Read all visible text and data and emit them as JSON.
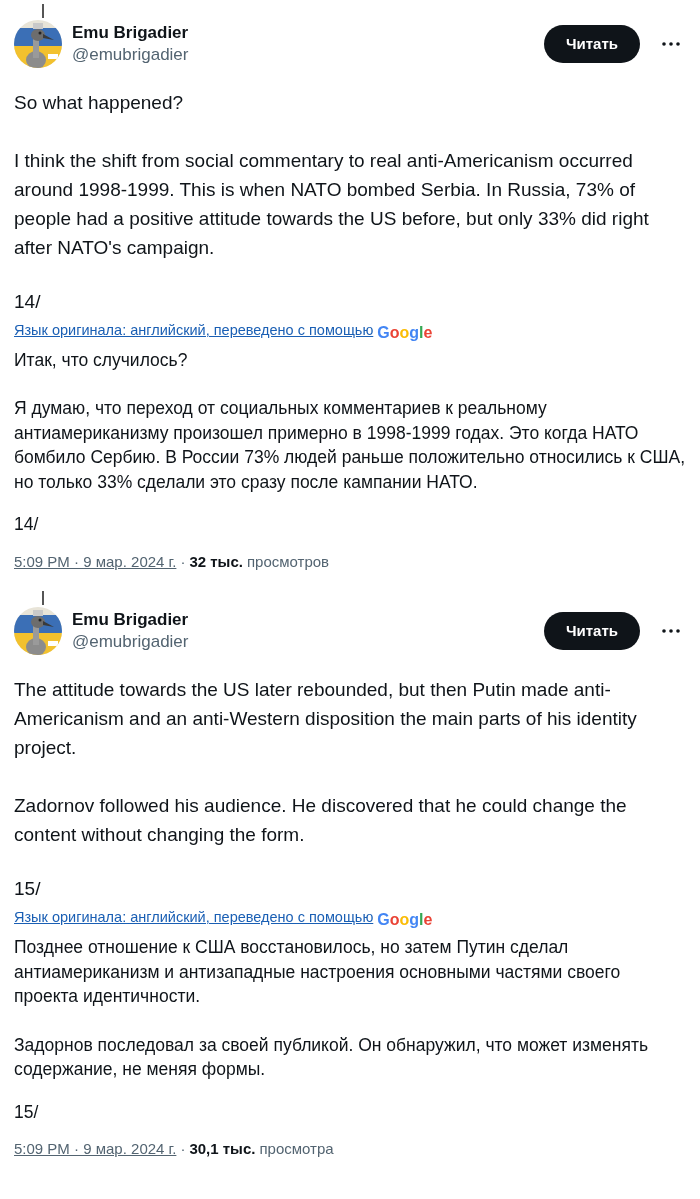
{
  "tweets": [
    {
      "author": {
        "name": "Emu Brigadier",
        "handle": "@emubrigadier"
      },
      "follow_button": "Читать",
      "original_paragraphs": [
        "So what happened?",
        "I think the shift from social commentary to real anti-Americanism occurred around 1998-1999. This is when NATO bombed Serbia. In Russia, 73% of people had a positive attitude towards the US before, but only 33% did right after NATO's campaign."
      ],
      "original_number": "14/",
      "translation_note": "Язык оригинала: английский, переведено с помощью",
      "translator": "Google",
      "translated_paragraphs": [
        "Итак, что случилось?",
        "Я думаю, что переход от социальных комментариев к реальному антиамериканизму произошел примерно в 1998-1999 годах. Это когда НАТО бомбило Сербию. В России 73% людей раньше положительно относились к США, но только 33% сделали это сразу после кампании НАТО."
      ],
      "translated_number": "14/",
      "timestamp": "5:09 PM · 9 мар. 2024 г.",
      "separator": "·",
      "views_count": "32 тыс.",
      "views_label": "просмотров"
    },
    {
      "author": {
        "name": "Emu Brigadier",
        "handle": "@emubrigadier"
      },
      "follow_button": "Читать",
      "original_paragraphs": [
        "The attitude towards the US later rebounded, but then Putin made anti-Americanism and an anti-Western disposition the main parts of his identity project.",
        "Zadornov followed his audience. He discovered that he could change the content without changing the form."
      ],
      "original_number": "15/",
      "translation_note": "Язык оригинала: английский, переведено с помощью",
      "translator": "Google",
      "translated_paragraphs": [
        "Позднее отношение к США восстановилось, но затем Путин сделал антиамериканизм и антизападные настроения основными частями своего проекта идентичности.",
        "Задорнов последовал за своей публикой. Он обнаружил, что может изменять содержание, не меняя формы."
      ],
      "translated_number": "15/",
      "timestamp": "5:09 PM · 9 мар. 2024 г.",
      "separator": "·",
      "views_count": "30,1 тыс.",
      "views_label": "просмотра"
    }
  ]
}
